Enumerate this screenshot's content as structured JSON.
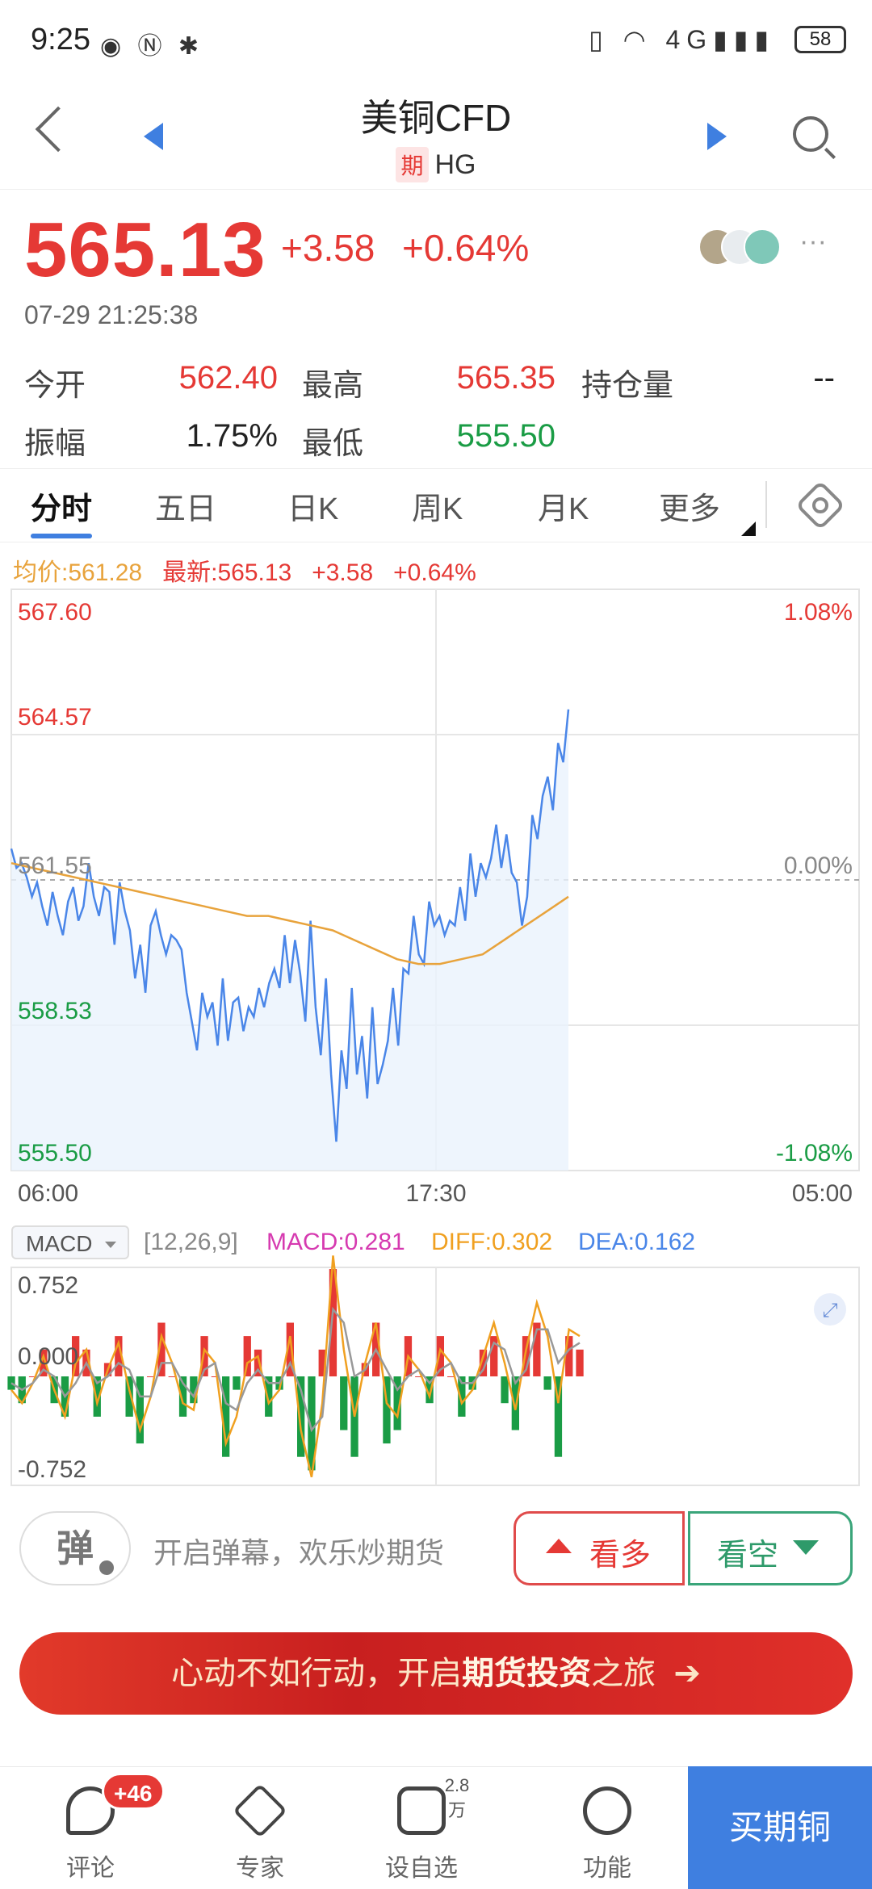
{
  "status_bar": {
    "time": "9:25",
    "battery": "58",
    "network": "4G"
  },
  "header": {
    "title": "美铜CFD",
    "tag": "期",
    "code": "HG"
  },
  "quote": {
    "price": "565.13",
    "change": "+3.58",
    "change_pct": "+0.64%",
    "timestamp": "07-29 21:25:38"
  },
  "stats": [
    {
      "label": "今开",
      "value": "562.40",
      "color": "#e53935"
    },
    {
      "label": "最高",
      "value": "565.35",
      "color": "#e53935"
    },
    {
      "label": "持仓量",
      "value": "--",
      "color": "#222222"
    },
    {
      "label": "振幅",
      "value": "1.75%",
      "color": "#222222"
    },
    {
      "label": "最低",
      "value": "555.50",
      "color": "#1a9c45"
    }
  ],
  "tabs": [
    "分时",
    "五日",
    "日K",
    "周K",
    "月K",
    "更多"
  ],
  "info_line": {
    "avg": "均价:561.28",
    "latest": "最新:565.13",
    "change": "+3.58",
    "change_pct": "+0.64%"
  },
  "chart_data": [
    {
      "type": "line",
      "title": "",
      "x_labels": [
        "06:00",
        "17:30",
        "05:00"
      ],
      "y_labels_left": [
        "567.60",
        "564.57",
        "561.55",
        "558.53",
        "555.50"
      ],
      "y_labels_right": [
        "1.08%",
        "0.00%",
        "-1.08%"
      ],
      "ylim": [
        555.5,
        567.6
      ],
      "baseline": 561.55,
      "series": [
        {
          "key": "price",
          "color": "#4a86e8",
          "values": [
            562.2,
            561.8,
            561.9,
            561.6,
            561.2,
            561.5,
            561.0,
            560.6,
            561.3,
            560.8,
            560.4,
            561.1,
            561.4,
            560.7,
            561.0,
            561.9,
            561.2,
            560.8,
            561.4,
            561.3,
            560.2,
            561.5,
            560.9,
            560.5,
            559.5,
            560.2,
            559.2,
            560.6,
            560.9,
            560.4,
            560.0,
            560.4,
            560.3,
            560.1,
            559.2,
            558.6,
            558.0,
            559.2,
            558.7,
            559.0,
            558.1,
            559.5,
            558.2,
            559.0,
            559.1,
            558.4,
            558.9,
            558.7,
            559.3,
            558.9,
            559.4,
            559.7,
            559.3,
            560.4,
            559.4,
            560.3,
            559.6,
            558.6,
            560.7,
            558.9,
            557.9,
            559.5,
            557.5,
            556.1,
            558.0,
            557.2,
            559.3,
            557.5,
            558.3,
            557.0,
            558.9,
            557.3,
            557.7,
            558.2,
            559.3,
            558.1,
            559.7,
            559.6,
            560.8,
            560.0,
            559.8,
            561.1,
            560.6,
            560.8,
            560.4,
            560.7,
            560.6,
            561.4,
            560.7,
            562.1,
            561.2,
            561.9,
            561.6,
            562.0,
            562.7,
            561.8,
            562.5,
            561.7,
            561.5,
            560.6,
            561.2,
            562.9,
            562.4,
            563.3,
            563.7,
            563.0,
            564.4,
            564.0,
            565.1
          ]
        },
        {
          "key": "avg",
          "color": "#e8a33c",
          "values": [
            561.9,
            561.8,
            561.7,
            561.6,
            561.5,
            561.4,
            561.3,
            561.2,
            561.1,
            561.0,
            560.9,
            560.8,
            560.8,
            560.7,
            560.6,
            560.5,
            560.3,
            560.1,
            559.9,
            559.8,
            559.8,
            559.9,
            560.0,
            560.3,
            560.6,
            560.9,
            561.2
          ]
        }
      ]
    },
    {
      "type": "line",
      "title": "",
      "indicator": "MACD",
      "params": "[12,26,9]",
      "macd_label": "MACD:0.281",
      "diff_label": "DIFF:0.302",
      "dea_label": "DEA:0.162",
      "y_labels": [
        "0.752",
        "0.000",
        "-0.752"
      ],
      "ylim": [
        -0.752,
        0.752
      ],
      "series": [
        {
          "name": "DIFF",
          "color": "#f0a020",
          "values": [
            -0.1,
            -0.2,
            -0.05,
            0.15,
            -0.1,
            -0.3,
            0.1,
            0.2,
            -0.2,
            0.05,
            0.25,
            -0.1,
            -0.4,
            -0.15,
            0.3,
            0.1,
            -0.2,
            -0.25,
            0.2,
            0.1,
            -0.5,
            -0.3,
            0.1,
            0.15,
            -0.2,
            -0.1,
            0.3,
            -0.4,
            -0.75,
            -0.2,
            0.9,
            0.2,
            -0.3,
            0.1,
            0.4,
            -0.2,
            -0.3,
            0.15,
            0.05,
            -0.15,
            0.2,
            0.1,
            -0.2,
            -0.1,
            0.15,
            0.4,
            0.1,
            -0.25,
            0.2,
            0.55,
            0.3,
            -0.2,
            0.35,
            0.3
          ]
        },
        {
          "name": "DEA",
          "color": "#999999",
          "values": [
            -0.05,
            -0.1,
            -0.05,
            0.05,
            0.0,
            -0.15,
            -0.05,
            0.1,
            -0.05,
            0.0,
            0.1,
            0.05,
            -0.15,
            -0.15,
            0.1,
            0.1,
            -0.05,
            -0.15,
            0.05,
            0.1,
            -0.2,
            -0.25,
            -0.05,
            0.05,
            -0.05,
            -0.05,
            0.1,
            -0.1,
            -0.4,
            -0.3,
            0.5,
            0.4,
            0.0,
            0.05,
            0.2,
            0.05,
            -0.1,
            0.0,
            0.05,
            -0.05,
            0.05,
            0.1,
            -0.05,
            -0.05,
            0.05,
            0.25,
            0.2,
            -0.05,
            0.05,
            0.35,
            0.35,
            0.1,
            0.2,
            0.25
          ]
        },
        {
          "name": "MACD",
          "values": [
            -0.1,
            -0.2,
            0.0,
            0.2,
            -0.2,
            -0.3,
            0.3,
            0.2,
            -0.3,
            0.1,
            0.3,
            -0.3,
            -0.5,
            0.0,
            0.4,
            0.0,
            -0.3,
            -0.2,
            0.3,
            0.0,
            -0.6,
            -0.1,
            0.3,
            0.2,
            -0.3,
            -0.1,
            0.4,
            -0.6,
            -0.7,
            0.2,
            0.8,
            -0.4,
            -0.6,
            0.1,
            0.4,
            -0.5,
            -0.4,
            0.3,
            0.0,
            -0.2,
            0.3,
            0.0,
            -0.3,
            -0.1,
            0.2,
            0.3,
            -0.2,
            -0.4,
            0.3,
            0.4,
            -0.1,
            -0.6,
            0.3,
            0.2
          ],
          "up_color": "#e53935",
          "down_color": "#1a9c45"
        }
      ]
    }
  ],
  "controls": {
    "danmu_button": "弹",
    "danmu_placeholder": "开启弹幕，欢乐炒期货",
    "bull_label": "看多",
    "bear_label": "看空"
  },
  "banner": {
    "prefix": "心动不如行动，开启",
    "bold": "期货投资",
    "suffix": "之旅",
    "arrow": "➔"
  },
  "bottom_nav": {
    "items": [
      {
        "label": "评论",
        "badge": "+46"
      },
      {
        "label": "专家"
      },
      {
        "label": "设自选",
        "superscript": "2.8万"
      },
      {
        "label": "功能"
      }
    ],
    "buy_label": "买期铜"
  }
}
